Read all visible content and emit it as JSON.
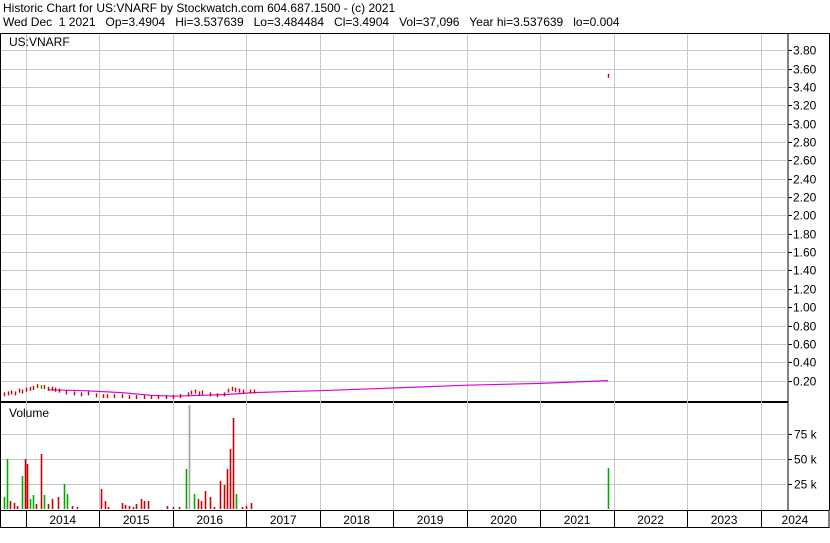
{
  "header": {
    "title": "Historic Chart for US:VNARF by Stockwatch.com 604.687.1500 - (c) 2021",
    "stats": "Wed Dec  1 2021   Op=3.4904   Hi=3.537639   Lo=3.484484   Cl=3.4904   Vol=37,096   Year hi=3.537639   lo=0.004"
  },
  "colors": {
    "up": "#00aa00",
    "down": "#cc0000",
    "moving_average": "#dd00dd",
    "grid": "#c8c8c8",
    "gray_bar": "#a0a0a0"
  },
  "chart_data": [
    {
      "type": "line",
      "name": "price",
      "title": "US:VNARF",
      "ylim": [
        0,
        3.9
      ],
      "yticks": [
        0.2,
        0.4,
        0.6,
        0.8,
        1.0,
        1.2,
        1.4,
        1.6,
        1.8,
        2.0,
        2.2,
        2.4,
        2.6,
        2.8,
        3.0,
        3.2,
        3.4,
        3.6,
        3.8
      ],
      "ytick_labels": [
        "0.20",
        "0.40",
        "0.60",
        "0.80",
        "1.00",
        "1.20",
        "1.40",
        "1.60",
        "1.80",
        "2.00",
        "2.20",
        "2.40",
        "2.60",
        "2.80",
        "3.00",
        "3.20",
        "3.40",
        "3.60",
        "3.80"
      ],
      "xlim": [
        2013.66,
        2024.37
      ],
      "x_year_labels": [
        "2014",
        "2015",
        "2016",
        "2017",
        "2018",
        "2019",
        "2020",
        "2021",
        "2022",
        "2023",
        "2024"
      ],
      "price_bars": [
        {
          "x": 2013.7,
          "v": 0.04,
          "c": "d"
        },
        {
          "x": 2013.75,
          "v": 0.05,
          "c": "d"
        },
        {
          "x": 2013.8,
          "v": 0.06,
          "c": "d"
        },
        {
          "x": 2013.85,
          "v": 0.05,
          "c": "d"
        },
        {
          "x": 2013.9,
          "v": 0.08,
          "c": "d"
        },
        {
          "x": 2013.95,
          "v": 0.07,
          "c": "d"
        },
        {
          "x": 2014.0,
          "v": 0.09,
          "c": "d"
        },
        {
          "x": 2014.05,
          "v": 0.1,
          "c": "d"
        },
        {
          "x": 2014.1,
          "v": 0.11,
          "c": "d"
        },
        {
          "x": 2014.15,
          "v": 0.13,
          "c": "d"
        },
        {
          "x": 2014.2,
          "v": 0.12,
          "c": "u"
        },
        {
          "x": 2014.25,
          "v": 0.12,
          "c": "d"
        },
        {
          "x": 2014.3,
          "v": 0.1,
          "c": "d"
        },
        {
          "x": 2014.35,
          "v": 0.1,
          "c": "d"
        },
        {
          "x": 2014.4,
          "v": 0.09,
          "c": "d"
        },
        {
          "x": 2014.45,
          "v": 0.08,
          "c": "d"
        },
        {
          "x": 2014.55,
          "v": 0.06,
          "c": "d"
        },
        {
          "x": 2014.65,
          "v": 0.05,
          "c": "d"
        },
        {
          "x": 2014.75,
          "v": 0.04,
          "c": "d"
        },
        {
          "x": 2014.85,
          "v": 0.05,
          "c": "d"
        },
        {
          "x": 2014.95,
          "v": 0.03,
          "c": "d"
        },
        {
          "x": 2015.05,
          "v": 0.02,
          "c": "d"
        },
        {
          "x": 2015.1,
          "v": 0.02,
          "c": "d"
        },
        {
          "x": 2015.2,
          "v": 0.02,
          "c": "d"
        },
        {
          "x": 2015.3,
          "v": 0.02,
          "c": "d"
        },
        {
          "x": 2015.4,
          "v": 0.01,
          "c": "d"
        },
        {
          "x": 2015.5,
          "v": 0.01,
          "c": "d"
        },
        {
          "x": 2015.6,
          "v": 0.01,
          "c": "d"
        },
        {
          "x": 2015.7,
          "v": 0.01,
          "c": "d"
        },
        {
          "x": 2015.8,
          "v": 0.01,
          "c": "d"
        },
        {
          "x": 2015.9,
          "v": 0.01,
          "c": "d"
        },
        {
          "x": 2016.0,
          "v": 0.01,
          "c": "d"
        },
        {
          "x": 2016.1,
          "v": 0.02,
          "c": "d"
        },
        {
          "x": 2016.2,
          "v": 0.04,
          "c": "d"
        },
        {
          "x": 2016.25,
          "v": 0.06,
          "c": "d"
        },
        {
          "x": 2016.3,
          "v": 0.07,
          "c": "d"
        },
        {
          "x": 2016.35,
          "v": 0.05,
          "c": "d"
        },
        {
          "x": 2016.4,
          "v": 0.06,
          "c": "d"
        },
        {
          "x": 2016.5,
          "v": 0.04,
          "c": "d"
        },
        {
          "x": 2016.6,
          "v": 0.03,
          "c": "d"
        },
        {
          "x": 2016.7,
          "v": 0.04,
          "c": "d"
        },
        {
          "x": 2016.75,
          "v": 0.08,
          "c": "d"
        },
        {
          "x": 2016.8,
          "v": 0.1,
          "c": "d"
        },
        {
          "x": 2016.85,
          "v": 0.09,
          "c": "d"
        },
        {
          "x": 2016.9,
          "v": 0.08,
          "c": "d"
        },
        {
          "x": 2016.95,
          "v": 0.07,
          "c": "d"
        },
        {
          "x": 2017.05,
          "v": 0.07,
          "c": "d"
        },
        {
          "x": 2017.1,
          "v": 0.07,
          "c": "d"
        },
        {
          "x": 2021.92,
          "v": 3.51,
          "c": "d"
        }
      ],
      "moving_average": {
        "x": [
          2014.3,
          2014.8,
          2015.3,
          2015.7,
          2016.0,
          2016.4,
          2016.75,
          2017.1,
          2017.5,
          2018.0,
          2019.0,
          2020.0,
          2021.0,
          2021.92
        ],
        "y": [
          0.1,
          0.09,
          0.07,
          0.04,
          0.03,
          0.04,
          0.05,
          0.07,
          0.08,
          0.09,
          0.12,
          0.15,
          0.17,
          0.2
        ]
      }
    },
    {
      "type": "bar",
      "name": "volume",
      "title": "Volume",
      "ylim": [
        0,
        95000
      ],
      "yticks": [
        25000,
        50000,
        75000
      ],
      "ytick_labels": [
        "25 k",
        "50 k",
        "75 k"
      ],
      "bars": [
        {
          "x": 2013.7,
          "v": 12000,
          "c": "u"
        },
        {
          "x": 2013.74,
          "v": 50000,
          "c": "u"
        },
        {
          "x": 2013.78,
          "v": 8000,
          "c": "d"
        },
        {
          "x": 2013.84,
          "v": 6000,
          "c": "d"
        },
        {
          "x": 2013.88,
          "v": 3000,
          "c": "d"
        },
        {
          "x": 2013.94,
          "v": 33000,
          "c": "u"
        },
        {
          "x": 2013.98,
          "v": 50000,
          "c": "d"
        },
        {
          "x": 2014.02,
          "v": 45000,
          "c": "d"
        },
        {
          "x": 2014.06,
          "v": 10000,
          "c": "u"
        },
        {
          "x": 2014.1,
          "v": 14000,
          "c": "u"
        },
        {
          "x": 2014.14,
          "v": 5000,
          "c": "d"
        },
        {
          "x": 2014.2,
          "v": 55000,
          "c": "d"
        },
        {
          "x": 2014.24,
          "v": 14000,
          "c": "u"
        },
        {
          "x": 2014.3,
          "v": 5000,
          "c": "d"
        },
        {
          "x": 2014.36,
          "v": 10000,
          "c": "d"
        },
        {
          "x": 2014.44,
          "v": 12000,
          "c": "d"
        },
        {
          "x": 2014.52,
          "v": 25000,
          "c": "u"
        },
        {
          "x": 2014.56,
          "v": 15000,
          "c": "u"
        },
        {
          "x": 2014.62,
          "v": 3000,
          "c": "d"
        },
        {
          "x": 2014.7,
          "v": 2000,
          "c": "d"
        },
        {
          "x": 2015.02,
          "v": 20000,
          "c": "d"
        },
        {
          "x": 2015.07,
          "v": 8000,
          "c": "d"
        },
        {
          "x": 2015.12,
          "v": 2000,
          "c": "d"
        },
        {
          "x": 2015.3,
          "v": 6000,
          "c": "d"
        },
        {
          "x": 2015.35,
          "v": 4000,
          "c": "d"
        },
        {
          "x": 2015.4,
          "v": 3000,
          "c": "d"
        },
        {
          "x": 2015.45,
          "v": 2000,
          "c": "d"
        },
        {
          "x": 2015.5,
          "v": 5000,
          "c": "d"
        },
        {
          "x": 2015.56,
          "v": 10000,
          "c": "d"
        },
        {
          "x": 2015.6,
          "v": 8000,
          "c": "d"
        },
        {
          "x": 2015.66,
          "v": 8000,
          "c": "d"
        },
        {
          "x": 2015.92,
          "v": 3000,
          "c": "d"
        },
        {
          "x": 2016.0,
          "v": 2000,
          "c": "d"
        },
        {
          "x": 2016.08,
          "v": 2000,
          "c": "d"
        },
        {
          "x": 2016.18,
          "v": 40000,
          "c": "u"
        },
        {
          "x": 2016.22,
          "v": 104000,
          "c": "g"
        },
        {
          "x": 2016.28,
          "v": 15000,
          "c": "u"
        },
        {
          "x": 2016.34,
          "v": 10000,
          "c": "d"
        },
        {
          "x": 2016.38,
          "v": 8000,
          "c": "d"
        },
        {
          "x": 2016.44,
          "v": 18000,
          "c": "d"
        },
        {
          "x": 2016.5,
          "v": 12000,
          "c": "d"
        },
        {
          "x": 2016.56,
          "v": 2000,
          "c": "d"
        },
        {
          "x": 2016.64,
          "v": 28000,
          "c": "d"
        },
        {
          "x": 2016.7,
          "v": 24000,
          "c": "d"
        },
        {
          "x": 2016.74,
          "v": 40000,
          "c": "d"
        },
        {
          "x": 2016.78,
          "v": 60000,
          "c": "d"
        },
        {
          "x": 2016.82,
          "v": 91000,
          "c": "d"
        },
        {
          "x": 2016.86,
          "v": 15000,
          "c": "u"
        },
        {
          "x": 2016.94,
          "v": 2000,
          "c": "d"
        },
        {
          "x": 2017.0,
          "v": 3000,
          "c": "d"
        },
        {
          "x": 2017.06,
          "v": 6000,
          "c": "d"
        },
        {
          "x": 2021.92,
          "v": 41000,
          "c": "u"
        }
      ]
    }
  ]
}
